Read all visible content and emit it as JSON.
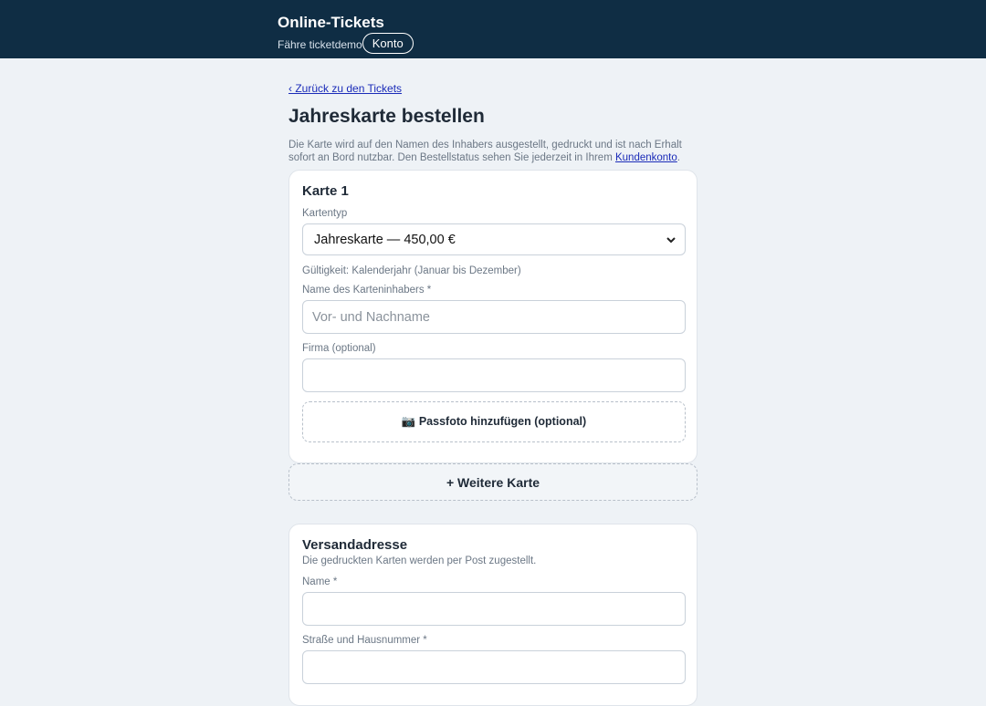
{
  "header": {
    "title": "Online-Tickets",
    "subtitle": "Fähre ticketdemo",
    "account_button": "Konto"
  },
  "nav": {
    "back_link": "‹ Zurück zu den Tickets"
  },
  "page": {
    "title": "Jahreskarte bestellen",
    "intro_text": "Die Karte wird auf den Namen des Inhabers ausgestellt, gedruckt und ist nach Erhalt sofort an Bord nutzbar. Den Bestellstatus sehen Sie jederzeit in Ihrem ",
    "intro_link": "Kundenkonto",
    "intro_end": "."
  },
  "card": {
    "title": "Karte 1",
    "type_label": "Kartentyp",
    "type_value": "Jahreskarte — 450,00 €",
    "validity": "Gültigkeit: Kalenderjahr (Januar bis Dezember)",
    "holder_label": "Name des Karteninhabers *",
    "holder_placeholder": "Vor- und Nachname",
    "company_label": "Firma (optional)",
    "company_value": "",
    "photo_button": "📷  Passfoto hinzufügen (optional)"
  },
  "add_card_button": "+ Weitere Karte",
  "shipping": {
    "title": "Versandadresse",
    "subtitle": "Die gedruckten Karten werden per Post zugestellt.",
    "name_label": "Name *",
    "name_value": "",
    "street_label": "Straße und Hausnummer *",
    "street_value": ""
  },
  "icons": {
    "chevron": "chevron-down-icon",
    "camera": "camera-icon"
  }
}
